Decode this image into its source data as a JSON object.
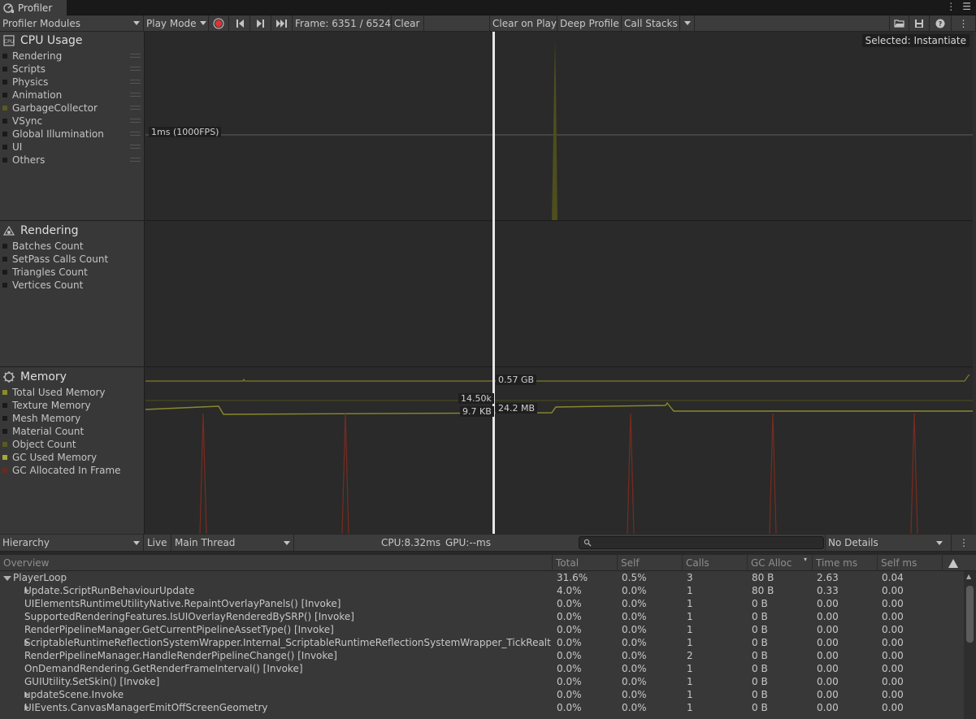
{
  "window": {
    "tab_title": "Profiler"
  },
  "toolbar": {
    "modules_label": "Profiler Modules",
    "play_mode_label": "Play Mode",
    "frame_label": "Frame: 6351 / 6524",
    "clear_label": "Clear",
    "clear_on_play_label": "Clear on Play",
    "deep_profile_label": "Deep Profile",
    "call_stacks_label": "Call Stacks"
  },
  "modules": [
    {
      "title": "CPU Usage",
      "icon": "cpu-icon",
      "legend": [
        {
          "label": "Rendering",
          "color": "#1a1a1a"
        },
        {
          "label": "Scripts",
          "color": "#1a1a1a"
        },
        {
          "label": "Physics",
          "color": "#1a1a1a"
        },
        {
          "label": "Animation",
          "color": "#1a1a1a"
        },
        {
          "label": "GarbageCollector",
          "color": "#5a5a22"
        },
        {
          "label": "VSync",
          "color": "#1a1a1a"
        },
        {
          "label": "Global Illumination",
          "color": "#1a1a1a"
        },
        {
          "label": "UI",
          "color": "#1a1a1a"
        },
        {
          "label": "Others",
          "color": "#1a1a1a"
        }
      ]
    },
    {
      "title": "Rendering",
      "icon": "rendering-icon",
      "legend": [
        {
          "label": "Batches Count",
          "color": "#1a1a1a"
        },
        {
          "label": "SetPass Calls Count",
          "color": "#1a1a1a"
        },
        {
          "label": "Triangles Count",
          "color": "#1a1a1a"
        },
        {
          "label": "Vertices Count",
          "color": "#1a1a1a"
        }
      ]
    },
    {
      "title": "Memory",
      "icon": "memory-icon",
      "legend": [
        {
          "label": "Total Used Memory",
          "color": "#8a8a2c"
        },
        {
          "label": "Texture Memory",
          "color": "#1a1a1a"
        },
        {
          "label": "Mesh Memory",
          "color": "#1a1a1a"
        },
        {
          "label": "Material Count",
          "color": "#1a1a1a"
        },
        {
          "label": "Object Count",
          "color": "#5a5a22"
        },
        {
          "label": "GC Used Memory",
          "color": "#a8a832"
        },
        {
          "label": "GC Allocated In Frame",
          "color": "#6a2a20"
        }
      ]
    }
  ],
  "graph": {
    "selected_label": "Selected: Instantiate",
    "cpu_threshold_label": "1ms (1000FPS)",
    "memory_labels": {
      "total": "0.57 GB",
      "objects": "14.50k",
      "gc_used": "24.2 MB",
      "gc_alloc": "9.7 KB"
    }
  },
  "hierarchy_bar": {
    "view_label": "Hierarchy",
    "live_label": "Live",
    "thread_label": "Main Thread",
    "cpu_label": "CPU:8.32ms",
    "gpu_label": "GPU:--ms",
    "details_label": "No Details"
  },
  "columns": [
    "Overview",
    "Total",
    "Self",
    "Calls",
    "GC Alloc",
    "Time ms",
    "Self ms"
  ],
  "rows": [
    {
      "name": "PlayerLoop",
      "indent": 0,
      "expander": "open",
      "total": "31.6%",
      "self": "0.5%",
      "calls": "3",
      "gc": "80 B",
      "time": "2.63",
      "selfms": "0.04"
    },
    {
      "name": "Update.ScriptRunBehaviourUpdate",
      "indent": 1,
      "expander": "closed",
      "total": "4.0%",
      "self": "0.0%",
      "calls": "1",
      "gc": "80 B",
      "time": "0.33",
      "selfms": "0.00"
    },
    {
      "name": "UIElementsRuntimeUtilityNative.RepaintOverlayPanels() [Invoke]",
      "indent": 1,
      "expander": "none",
      "total": "0.0%",
      "self": "0.0%",
      "calls": "1",
      "gc": "0 B",
      "time": "0.00",
      "selfms": "0.00"
    },
    {
      "name": "SupportedRenderingFeatures.IsUIOverlayRenderedBySRP() [Invoke]",
      "indent": 1,
      "expander": "none",
      "total": "0.0%",
      "self": "0.0%",
      "calls": "1",
      "gc": "0 B",
      "time": "0.00",
      "selfms": "0.00"
    },
    {
      "name": "RenderPipelineManager.GetCurrentPipelineAssetType() [Invoke]",
      "indent": 1,
      "expander": "none",
      "total": "0.0%",
      "self": "0.0%",
      "calls": "1",
      "gc": "0 B",
      "time": "0.00",
      "selfms": "0.00"
    },
    {
      "name": "ScriptableRuntimeReflectionSystemWrapper.Internal_ScriptableRuntimeReflectionSystemWrapper_TickRealtimeProl",
      "indent": 1,
      "expander": "closed",
      "total": "0.0%",
      "self": "0.0%",
      "calls": "1",
      "gc": "0 B",
      "time": "0.00",
      "selfms": "0.00"
    },
    {
      "name": "RenderPipelineManager.HandleRenderPipelineChange() [Invoke]",
      "indent": 1,
      "expander": "none",
      "total": "0.0%",
      "self": "0.0%",
      "calls": "2",
      "gc": "0 B",
      "time": "0.00",
      "selfms": "0.00"
    },
    {
      "name": "OnDemandRendering.GetRenderFrameInterval() [Invoke]",
      "indent": 1,
      "expander": "none",
      "total": "0.0%",
      "self": "0.0%",
      "calls": "1",
      "gc": "0 B",
      "time": "0.00",
      "selfms": "0.00"
    },
    {
      "name": "GUIUtility.SetSkin() [Invoke]",
      "indent": 1,
      "expander": "none",
      "total": "0.0%",
      "self": "0.0%",
      "calls": "1",
      "gc": "0 B",
      "time": "0.00",
      "selfms": "0.00"
    },
    {
      "name": "updateScene.Invoke",
      "indent": 1,
      "expander": "closed",
      "total": "0.0%",
      "self": "0.0%",
      "calls": "1",
      "gc": "0 B",
      "time": "0.00",
      "selfms": "0.00"
    },
    {
      "name": "UIEvents.CanvasManagerEmitOffScreenGeometry",
      "indent": 1,
      "expander": "closed",
      "total": "0.0%",
      "self": "0.0%",
      "calls": "1",
      "gc": "0 B",
      "time": "0.00",
      "selfms": "0.00"
    }
  ]
}
